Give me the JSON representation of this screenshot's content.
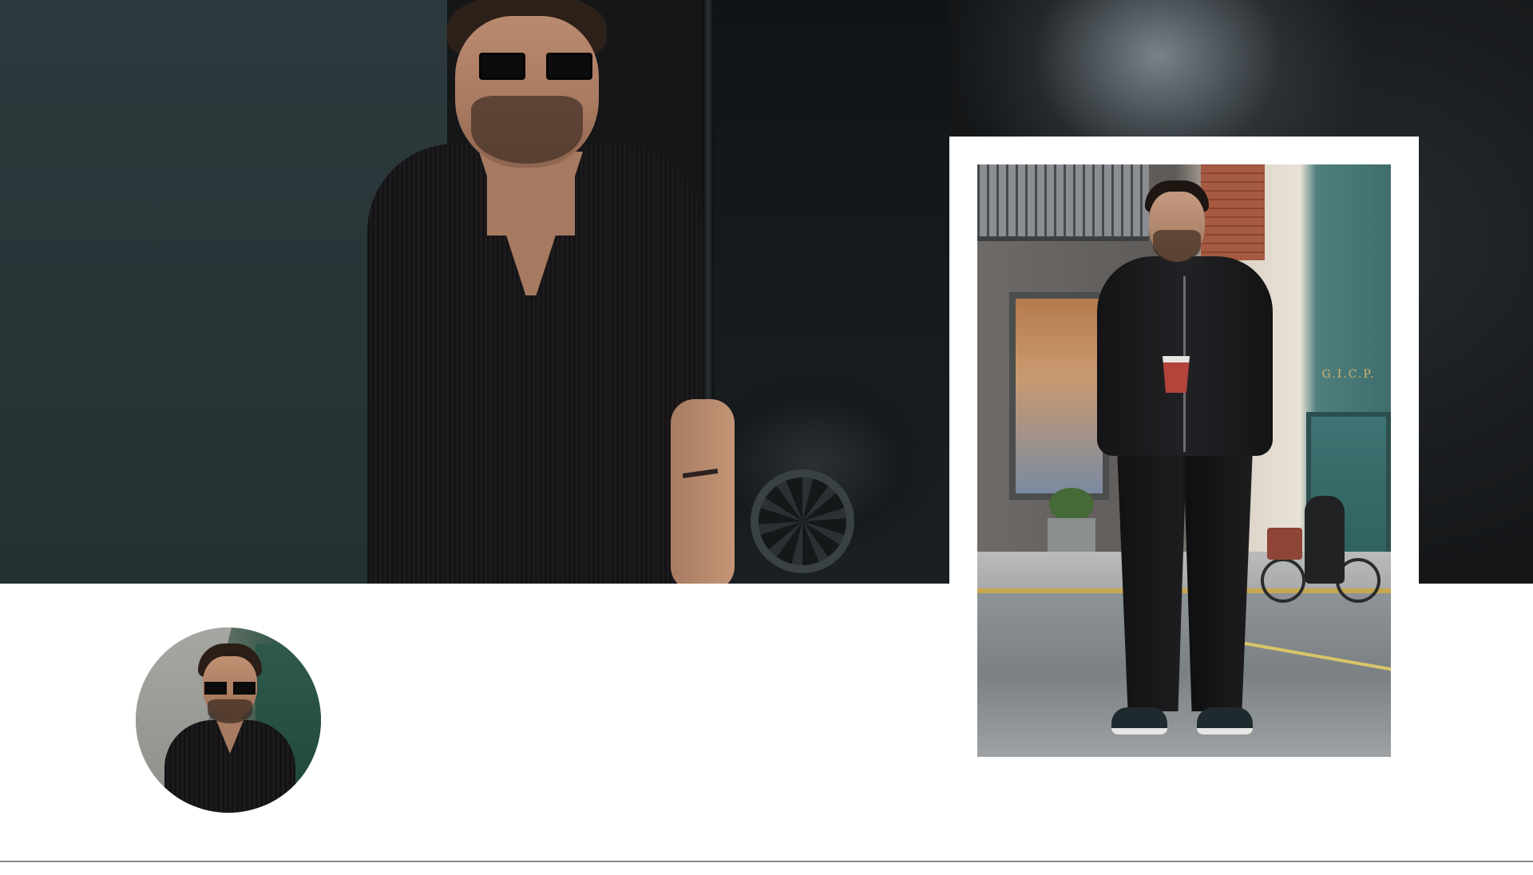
{
  "hero": {
    "description_icon": "hero-photo"
  },
  "feature_card": {
    "storefront_sign": "G.I.C.P."
  },
  "avatar": {
    "icon": "profile-photo"
  }
}
